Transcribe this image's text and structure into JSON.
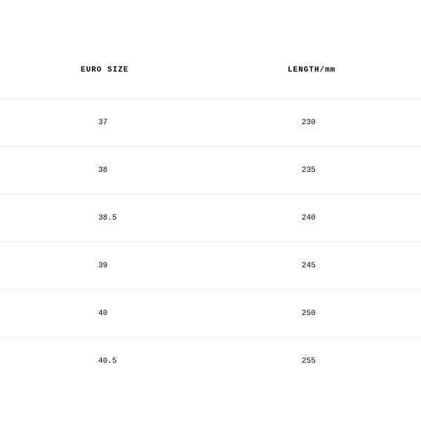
{
  "table": {
    "headers": {
      "euro_size": "EURO SIZE",
      "length": "LENGTH/mm"
    },
    "rows": [
      {
        "euro_size": "37",
        "length": "230"
      },
      {
        "euro_size": "38",
        "length": "235"
      },
      {
        "euro_size": "38.5",
        "length": "240"
      },
      {
        "euro_size": "39",
        "length": "245"
      },
      {
        "euro_size": "40",
        "length": "250"
      },
      {
        "euro_size": "40.5",
        "length": "255"
      }
    ]
  }
}
